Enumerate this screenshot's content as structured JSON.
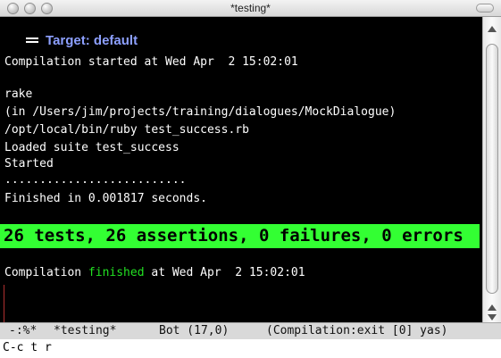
{
  "window": {
    "title": "*testing*"
  },
  "terminal": {
    "header": "Target: default",
    "compile_start": "Compilation started at Wed Apr  2 15:02:01",
    "output_lines": [
      "rake",
      "(in /Users/jim/projects/training/dialogues/MockDialogue)",
      "/opt/local/bin/ruby test_success.rb",
      "Loaded suite test_success",
      "Started",
      "..........................",
      "Finished in 0.001817 seconds."
    ],
    "summary": "26 tests, 26 assertions, 0 failures, 0 errors",
    "summary_color": "#33ff33",
    "compile_end": {
      "prefix": "Compilation ",
      "word": "finished",
      "suffix": " at Wed Apr  2 15:02:01"
    }
  },
  "modeline": {
    "state": "-:%*",
    "buffer": "*testing*",
    "position": "Bot (17,0)",
    "mode": "(Compilation:exit [0] yas)"
  },
  "minibuffer": {
    "text": "C-c t r"
  }
}
